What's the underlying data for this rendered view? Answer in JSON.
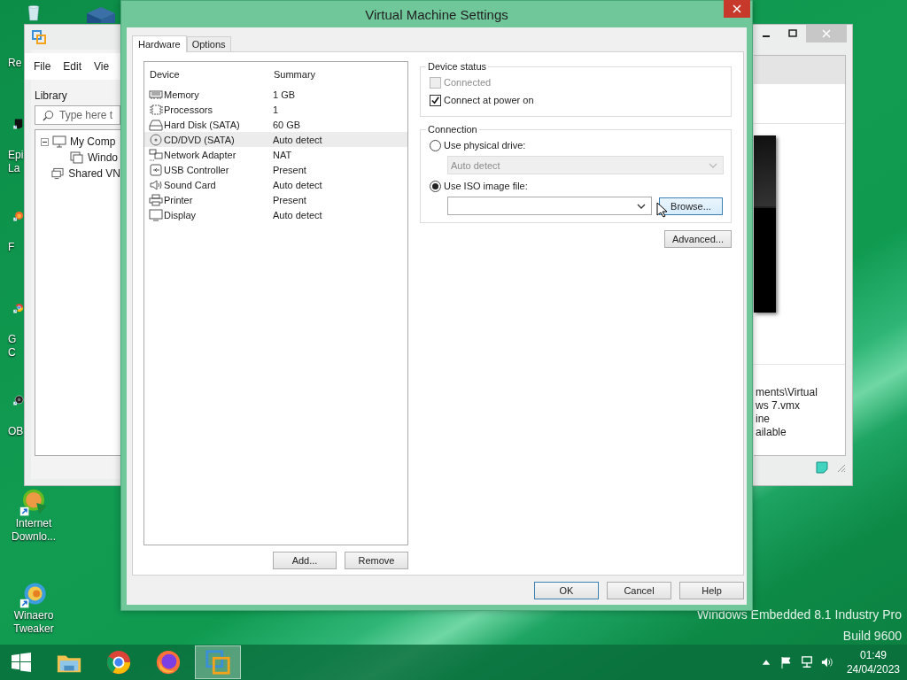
{
  "desktop_icons": [
    {
      "kind": "recycle",
      "lines": [
        "Re"
      ]
    },
    {
      "kind": "epic",
      "lines": [
        "Epi",
        "La"
      ]
    },
    {
      "kind": "fox",
      "lines": [
        "F"
      ]
    },
    {
      "kind": "chrome",
      "lines": [
        "G",
        "C"
      ]
    },
    {
      "kind": "obs",
      "lines": [
        "OB"
      ]
    },
    {
      "kind": "idm",
      "lines": [
        "Internet",
        "Downlo..."
      ]
    },
    {
      "kind": "winaero",
      "lines": [
        "Winaero",
        "Tweaker"
      ]
    }
  ],
  "background_window": {
    "menu": [
      "File",
      "Edit",
      "Vie"
    ],
    "library_title": "Library",
    "search": {
      "placeholder": "Type here t"
    },
    "tree": [
      {
        "label": "My Comp",
        "kind": "computer",
        "expanded": true,
        "children": [
          {
            "label": "Windo",
            "kind": "vm"
          }
        ]
      },
      {
        "label": "Shared VN",
        "kind": "shared"
      }
    ],
    "details": [
      "ments\\Virtual",
      "ws 7.vmx",
      "ine",
      "ailable"
    ]
  },
  "dialog": {
    "title": "Virtual Machine Settings",
    "tabs": [
      {
        "label": "Hardware",
        "selected": true
      },
      {
        "label": "Options",
        "selected": false
      }
    ],
    "columns": [
      "Device",
      "Summary"
    ],
    "devices": [
      {
        "kind": "memory",
        "name": "Memory",
        "summary": "1 GB",
        "selected": false
      },
      {
        "kind": "cpu",
        "name": "Processors",
        "summary": "1",
        "selected": false
      },
      {
        "kind": "disk",
        "name": "Hard Disk (SATA)",
        "summary": "60 GB",
        "selected": false
      },
      {
        "kind": "cd",
        "name": "CD/DVD (SATA)",
        "summary": "Auto detect",
        "selected": true
      },
      {
        "kind": "network",
        "name": "Network Adapter",
        "summary": "NAT",
        "selected": false
      },
      {
        "kind": "usb",
        "name": "USB Controller",
        "summary": "Present",
        "selected": false
      },
      {
        "kind": "sound",
        "name": "Sound Card",
        "summary": "Auto detect",
        "selected": false
      },
      {
        "kind": "printer",
        "name": "Printer",
        "summary": "Present",
        "selected": false
      },
      {
        "kind": "display",
        "name": "Display",
        "summary": "Auto detect",
        "selected": false
      }
    ],
    "list_buttons": [
      "Add...",
      "Remove"
    ],
    "device_status": {
      "title": "Device status",
      "checkboxes": [
        {
          "label": "Connected",
          "checked": false,
          "disabled": true
        },
        {
          "label": "Connect at power on",
          "checked": true,
          "disabled": false
        }
      ]
    },
    "connection": {
      "title": "Connection",
      "physical": {
        "label": "Use physical drive:",
        "selected": false,
        "drive": "Auto detect",
        "disabled": true
      },
      "iso": {
        "label": "Use ISO image file:",
        "selected": true,
        "browse": "Browse..."
      }
    },
    "advanced": "Advanced...",
    "footer_buttons": [
      {
        "label": "OK",
        "default": true
      },
      {
        "label": "Cancel",
        "default": false
      },
      {
        "label": "Help",
        "default": false
      }
    ]
  },
  "os_watermark": [
    "Windows Embedded 8.1 Industry Pro",
    "Build 9600"
  ],
  "taskbar": {
    "apps": [
      {
        "kind": "explorer",
        "active": false
      },
      {
        "kind": "chrome",
        "active": false
      },
      {
        "kind": "firefox",
        "active": false
      },
      {
        "kind": "vmware",
        "active": true
      }
    ],
    "time": "01:49",
    "date": "24/04/2023"
  }
}
